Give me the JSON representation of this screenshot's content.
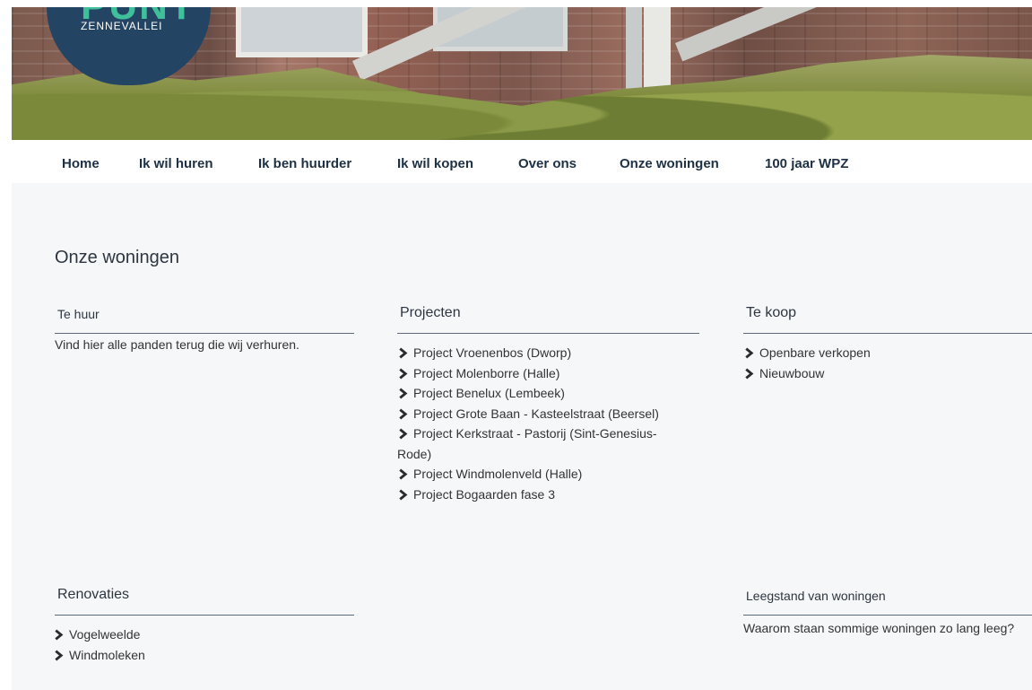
{
  "logo": {
    "text": "PUNT",
    "subtext": "ZENNEVALLEI"
  },
  "nav": {
    "items": [
      {
        "label": "Home"
      },
      {
        "label": "Ik wil huren"
      },
      {
        "label": "Ik ben huurder"
      },
      {
        "label": "Ik wil kopen"
      },
      {
        "label": "Over ons"
      },
      {
        "label": "Onze woningen"
      },
      {
        "label": "100 jaar WPZ"
      }
    ]
  },
  "page": {
    "title": "Onze woningen"
  },
  "sections": {
    "te_huur": {
      "title": "Te huur",
      "description": "Vind hier alle panden terug die wij verhuren."
    },
    "projecten": {
      "title": "Projecten",
      "items": [
        {
          "label": "Project Vroenenbos (Dworp)"
        },
        {
          "label": "Project Molenborre (Halle)"
        },
        {
          "label": "Project Benelux (Lembeek)"
        },
        {
          "label": "Project Grote Baan - Kasteelstraat (Beersel)"
        },
        {
          "label": "Project Kerkstraat - Pastorij (Sint-Genesius-Rode)"
        },
        {
          "label": "Project Windmolenveld (Halle)"
        },
        {
          "label": "Project Bogaarden fase 3"
        }
      ]
    },
    "te_koop": {
      "title": "Te koop",
      "items": [
        {
          "label": "Openbare verkopen"
        },
        {
          "label": "Nieuwbouw"
        }
      ]
    },
    "renovaties": {
      "title": "Renovaties",
      "items": [
        {
          "label": "Vogelweelde"
        },
        {
          "label": "Windmoleken"
        }
      ]
    },
    "leegstand": {
      "title": "Leegstand van woningen",
      "description": "Waarom staan sommige woningen zo lang leeg?"
    }
  },
  "colors": {
    "logo_bg": "#234463",
    "logo_accent": "#3fbf9a",
    "nav_text": "#1e3044",
    "content_bg": "#f6f7f8",
    "divider": "#5a6b7b"
  },
  "icons": {
    "link_marker": "chevron-right-icon"
  }
}
